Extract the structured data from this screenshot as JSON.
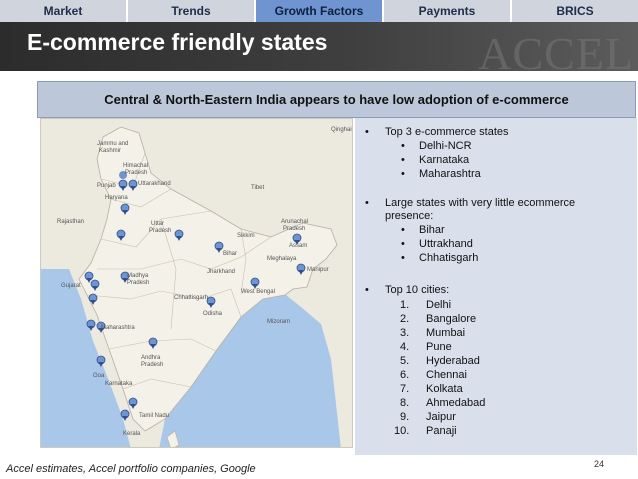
{
  "tabs": [
    {
      "label": "Market",
      "active": false
    },
    {
      "label": "Trends",
      "active": false
    },
    {
      "label": "Growth Factors",
      "active": true
    },
    {
      "label": "Payments",
      "active": false
    },
    {
      "label": "BRICS",
      "active": false
    }
  ],
  "header": {
    "title": "E-commerce friendly states",
    "logo": "ACCEL"
  },
  "banner": "Central & North-Eastern India appears to have low adoption of e-commerce",
  "map": {
    "labels": {
      "qinghai": "Qinghai",
      "jammu": "Jammu and",
      "kashmir": "Kashmir",
      "himachal": "Himachal",
      "pradesh_h": "Pradesh",
      "punjab": "Punjab",
      "uttarakhand": "Uttarakhand",
      "haryana": "Haryana",
      "tibet": "Tibet",
      "uttar": "Uttar",
      "pradesh_u": "Pradesh",
      "rajasthan": "Rajasthan",
      "arunachal": "Arunachal",
      "pradesh_a": "Pradesh",
      "sikkim": "Sikkim",
      "assam": "Assam",
      "meghalaya": "Meghalaya",
      "bihar": "Bihar",
      "manipur": "Manipur",
      "jharkhand": "Jharkhand",
      "madhya": "Madhya",
      "pradesh_m": "Pradesh",
      "gujarat": "Gujarat",
      "chhattisgarh": "Chhattisgarh",
      "west_bengal": "West Bengal",
      "odisha": "Odisha",
      "mizoram": "Mizoram",
      "maharashtra": "Maharashtra",
      "andhra": "Andhra",
      "pradesh_ap": "Pradesh",
      "goa": "Goa",
      "karnataka": "Karnataka",
      "tamil_nadu": "Tamil Nadu",
      "kerala": "Kerala"
    },
    "pin_color": "#6f94cf"
  },
  "panel": {
    "top3_title": "Top 3 e-commerce states",
    "top3": [
      "Delhi-NCR",
      "Karnataka",
      "Maharashtra"
    ],
    "large_title_1": "Large states with very little ecommerce",
    "large_title_2": "presence:",
    "large": [
      "Bihar",
      "Uttrakhand",
      "Chhatisgarh"
    ],
    "cities_title": "Top 10 cities:",
    "cities": [
      {
        "num": "1.",
        "name": "Delhi"
      },
      {
        "num": "2.",
        "name": "Bangalore"
      },
      {
        "num": "3.",
        "name": "Mumbai"
      },
      {
        "num": "4.",
        "name": "Pune"
      },
      {
        "num": "5.",
        "name": "Hyderabad"
      },
      {
        "num": "6.",
        "name": "Chennai"
      },
      {
        "num": "7.",
        "name": "Kolkata"
      },
      {
        "num": "8.",
        "name": "Ahmedabad"
      },
      {
        "num": "9.",
        "name": "Jaipur"
      },
      {
        "num": "10.",
        "name": "Panaji"
      }
    ]
  },
  "footer": {
    "source": "Accel estimates, Accel portfolio companies, Google",
    "page": "24"
  }
}
